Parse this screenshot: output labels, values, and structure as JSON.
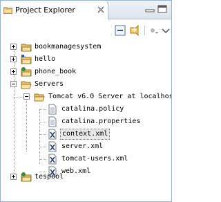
{
  "view": {
    "title": "Project Explorer"
  },
  "tree": {
    "projects": [
      {
        "label": "bookmanagesystem"
      },
      {
        "label": "hello"
      },
      {
        "label": "phone_book"
      },
      {
        "label": "Servers"
      }
    ],
    "server": {
      "label": "Tomcat v6.0 Server at localhos"
    },
    "files": [
      {
        "label": "catalina.policy"
      },
      {
        "label": "catalina.properties"
      },
      {
        "label": "context.xml"
      },
      {
        "label": "server.xml"
      },
      {
        "label": "tomcat-users.xml"
      },
      {
        "label": "web.xml"
      }
    ],
    "last_project": {
      "label": "tespool"
    }
  },
  "colors": {
    "selection": "#e8e8e8",
    "folder": "#e9c46a",
    "tab_border": "#a9b8c9"
  }
}
